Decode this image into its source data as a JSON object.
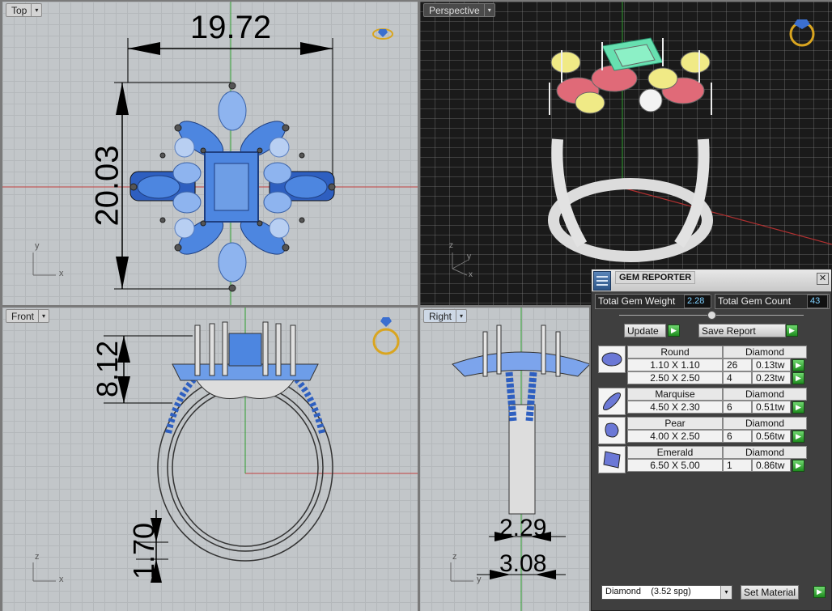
{
  "viewports": {
    "top": {
      "title": "Top",
      "dim_width": "19.72",
      "dim_height": "20.03",
      "axis_y": "y",
      "axis_x": "x"
    },
    "perspective": {
      "title": "Perspective",
      "axis_z": "z",
      "axis_y": "y",
      "axis_x": "x"
    },
    "front": {
      "title": "Front",
      "dim_prong": "8.12",
      "dim_shank": "1.70",
      "axis_z": "z",
      "axis_x": "x"
    },
    "right": {
      "title": "Right",
      "dim_inner": "2.29",
      "dim_outer": "3.08",
      "axis_z": "z",
      "axis_y": "y"
    }
  },
  "gem_reporter": {
    "title": "GEM REPORTER",
    "close": "✕",
    "total_weight_label": "Total Gem Weight",
    "total_weight_value": "2.28",
    "total_count_label": "Total Gem Count",
    "total_count_value": "43",
    "update_label": "Update",
    "save_report_label": "Save Report",
    "gems": [
      {
        "shape": "Round",
        "material": "Diamond",
        "rows": [
          {
            "size": "1.10 X 1.10",
            "count": "26",
            "weight": "0.13tw"
          },
          {
            "size": "2.50 X 2.50",
            "count": "4",
            "weight": "0.23tw"
          }
        ]
      },
      {
        "shape": "Marquise",
        "material": "Diamond",
        "rows": [
          {
            "size": "4.50 X 2.30",
            "count": "6",
            "weight": "0.51tw"
          }
        ]
      },
      {
        "shape": "Pear",
        "material": "Diamond",
        "rows": [
          {
            "size": "4.00 X 2.50",
            "count": "6",
            "weight": "0.56tw"
          }
        ]
      },
      {
        "shape": "Emerald",
        "material": "Diamond",
        "rows": [
          {
            "size": "6.50 X 5.00",
            "count": "1",
            "weight": "0.86tw"
          }
        ]
      }
    ],
    "material_select": "Diamond    (3.52 spg)",
    "set_material_label": "Set Material"
  },
  "colors": {
    "gem_blue": "#4d86e0",
    "metal": "#d0d0d0",
    "panel_bg": "#3f3f3f",
    "accent_green": "#2aa02a"
  }
}
